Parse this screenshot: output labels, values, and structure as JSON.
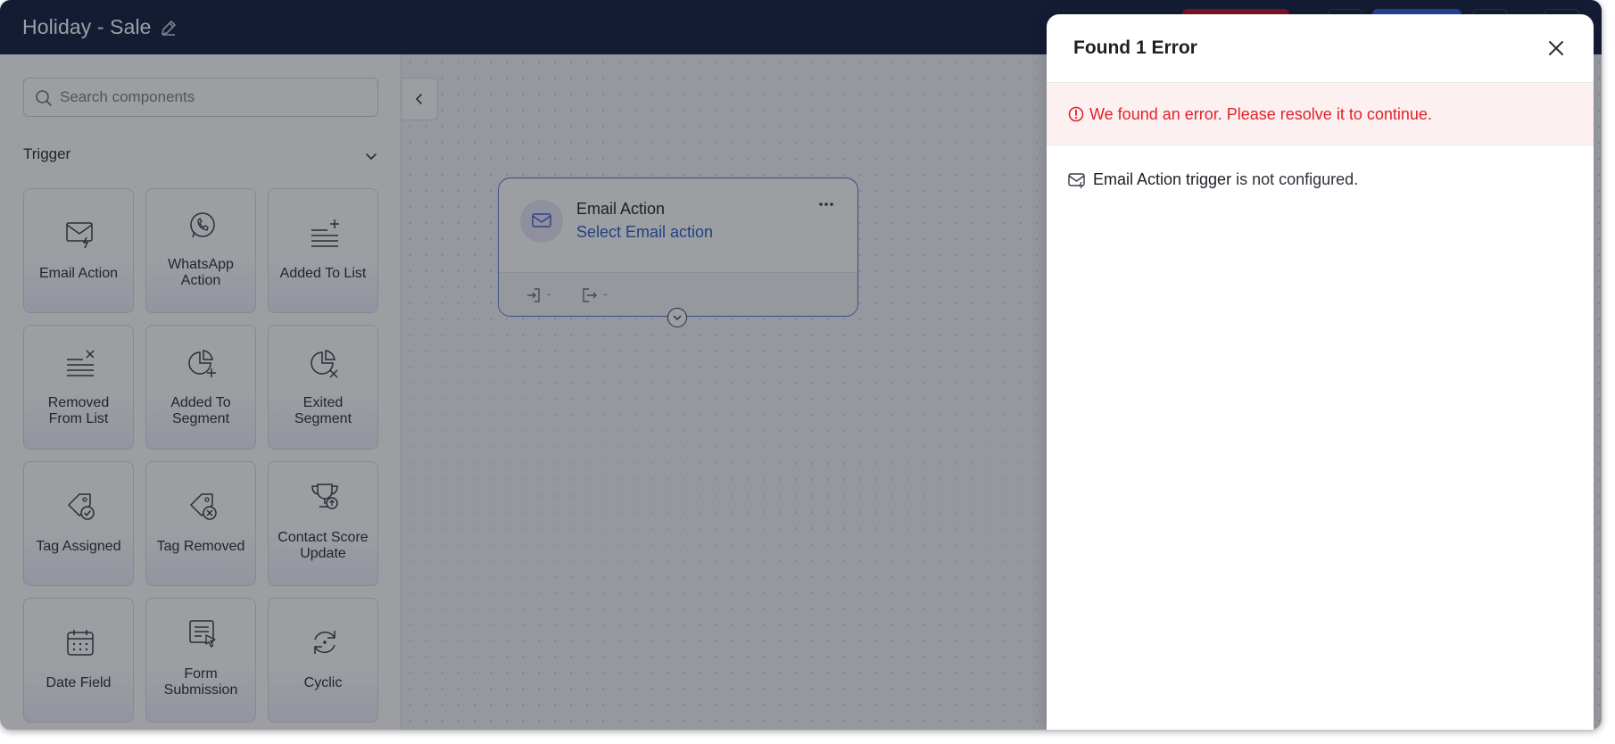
{
  "header": {
    "title": "Holiday - Sale"
  },
  "sidebar": {
    "search_placeholder": "Search components",
    "section_title": "Trigger",
    "tiles": [
      {
        "label_lines": [
          "Email Action"
        ],
        "icon": "email-lightning-icon"
      },
      {
        "label_lines": [
          "WhatsApp",
          "Action"
        ],
        "icon": "whatsapp-icon"
      },
      {
        "label_lines": [
          "Added To List"
        ],
        "icon": "list-add-icon"
      },
      {
        "label_lines": [
          "Removed",
          "From List"
        ],
        "icon": "list-remove-icon"
      },
      {
        "label_lines": [
          "Added To",
          "Segment"
        ],
        "icon": "pie-add-icon"
      },
      {
        "label_lines": [
          "Exited",
          "Segment"
        ],
        "icon": "pie-remove-icon"
      },
      {
        "label_lines": [
          "Tag Assigned"
        ],
        "icon": "tag-check-icon"
      },
      {
        "label_lines": [
          "Tag Removed"
        ],
        "icon": "tag-remove-icon"
      },
      {
        "label_lines": [
          "Contact Score",
          "Update"
        ],
        "icon": "trophy-icon"
      },
      {
        "label_lines": [
          "Date Field"
        ],
        "icon": "calendar-icon"
      },
      {
        "label_lines": [
          "Form",
          "Submission"
        ],
        "icon": "form-cursor-icon"
      },
      {
        "label_lines": [
          "Cyclic"
        ],
        "icon": "cyclic-arrows-icon"
      }
    ]
  },
  "canvas": {
    "node": {
      "title": "Email Action",
      "subtitle": "Select Email action",
      "entry_count": "-",
      "exit_count": "-"
    }
  },
  "error_drawer": {
    "title": "Found 1 Error",
    "banner": "We found an error. Please resolve it to continue.",
    "errors": [
      {
        "bold": "Email Action trigger",
        "rest": " is not configured."
      }
    ]
  },
  "colors": {
    "topbar": "#142040",
    "error_red": "#e0232b",
    "link_blue": "#2a62c7",
    "node_border": "#5b6fd6"
  }
}
